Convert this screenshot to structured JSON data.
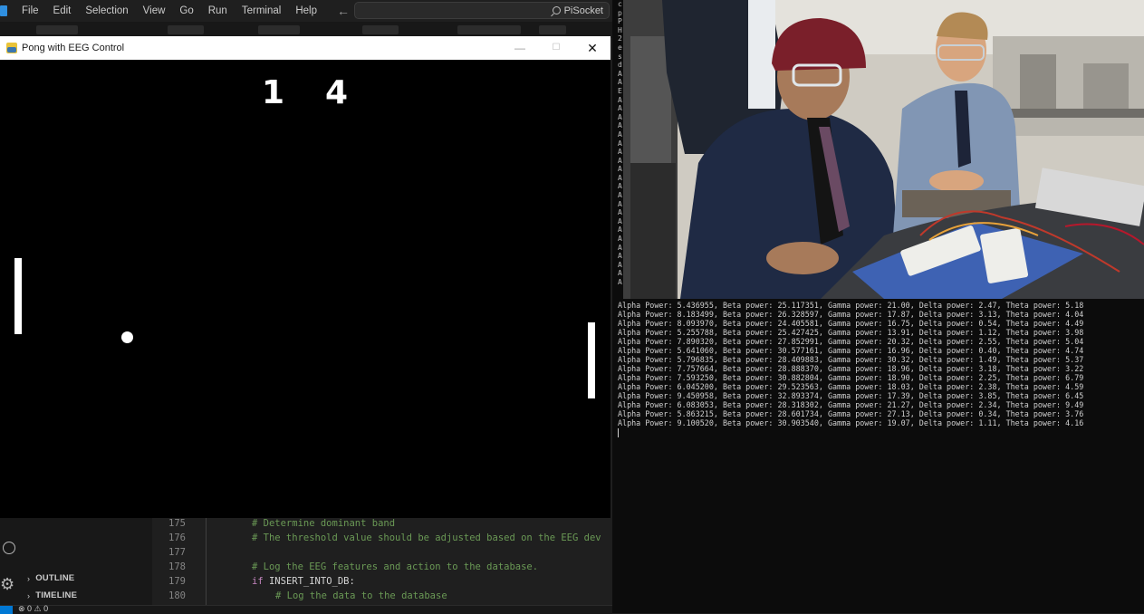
{
  "menubar": {
    "items": [
      "File",
      "Edit",
      "Selection",
      "View",
      "Go",
      "Run",
      "Terminal",
      "Help"
    ],
    "back_icon": "arrow-left-icon",
    "forward_icon": "arrow-right-icon",
    "command_center": "PiSocket"
  },
  "pong": {
    "title": "Pong with EEG Control",
    "minimize": "—",
    "maximize": "☐",
    "close": "✕",
    "score_left": "1",
    "score_right": "4"
  },
  "sidebar": {
    "outline_label": "OUTLINE",
    "timeline_label": "TIMELINE",
    "chevron": "›"
  },
  "editor": {
    "lines": [
      {
        "num": "175",
        "comment": "# Determine dominant band"
      },
      {
        "num": "176",
        "comment": "# The threshold value should be adjusted based on the EEG dev"
      },
      {
        "num": "177",
        "comment": ""
      },
      {
        "num": "178",
        "comment": "# Log the EEG features and action to the database."
      },
      {
        "num": "179",
        "keyword": "if",
        "ident": "INSERT_INTO_DB",
        "tail": ":"
      },
      {
        "num": "180",
        "comment": "# Log the data to the database"
      }
    ]
  },
  "statusbar": {
    "problems": "⊗ 0 ⚠ 0"
  },
  "terminal": {
    "gutter": [
      "c",
      "p",
      "P",
      "H",
      "2",
      "e",
      "s",
      "d",
      "A",
      "A",
      "E",
      "A",
      "A",
      "A",
      "A",
      "A",
      "A",
      "A",
      "A",
      "A",
      "A",
      "A",
      "A",
      "A",
      "A",
      "A",
      "A",
      "A",
      "A",
      "A",
      "A",
      "A",
      "A"
    ],
    "lines": [
      "Alpha Power: 5.436955, Beta power: 25.117351, Gamma power: 21.00, Delta power: 2.47, Theta power: 5.18",
      "Alpha Power: 8.183499, Beta power: 26.328597, Gamma power: 17.87, Delta power: 3.13, Theta power: 4.04",
      "Alpha Power: 8.093970, Beta power: 24.405581, Gamma power: 16.75, Delta power: 0.54, Theta power: 4.49",
      "Alpha Power: 5.255788, Beta power: 25.427425, Gamma power: 13.91, Delta power: 1.12, Theta power: 3.98",
      "Alpha Power: 7.890320, Beta power: 27.852991, Gamma power: 20.32, Delta power: 2.55, Theta power: 5.04",
      "Alpha Power: 5.641060, Beta power: 30.577161, Gamma power: 16.96, Delta power: 0.40, Theta power: 4.74",
      "Alpha Power: 5.796835, Beta power: 28.409883, Gamma power: 30.32, Delta power: 1.49, Theta power: 5.37",
      "Alpha Power: 7.757664, Beta power: 28.888370, Gamma power: 18.96, Delta power: 3.18, Theta power: 3.22",
      "Alpha Power: 7.593250, Beta power: 30.882804, Gamma power: 18.90, Delta power: 2.25, Theta power: 6.79",
      "Alpha Power: 6.045200, Beta power: 29.523563, Gamma power: 18.03, Delta power: 2.38, Theta power: 4.59",
      "Alpha Power: 9.450958, Beta power: 32.893374, Gamma power: 17.39, Delta power: 3.85, Theta power: 6.45",
      "Alpha Power: 6.083053, Beta power: 28.318302, Gamma power: 21.27, Delta power: 2.34, Theta power: 9.49",
      "Alpha Power: 5.863215, Beta power: 28.601734, Gamma power: 27.13, Delta power: 0.34, Theta power: 3.76",
      "Alpha Power: 9.100520, Beta power: 30.903540, Gamma power: 19.07, Delta power: 1.11, Theta power: 4.16"
    ]
  },
  "colors": {
    "vscode_bg": "#1f1f1f",
    "accent_blue": "#0078d4",
    "comment_green": "#6a9955",
    "keyword_purple": "#c586c0",
    "terminal_bg": "#0c0c0c",
    "pong_bg": "#000000",
    "pong_fg": "#ffffff"
  }
}
